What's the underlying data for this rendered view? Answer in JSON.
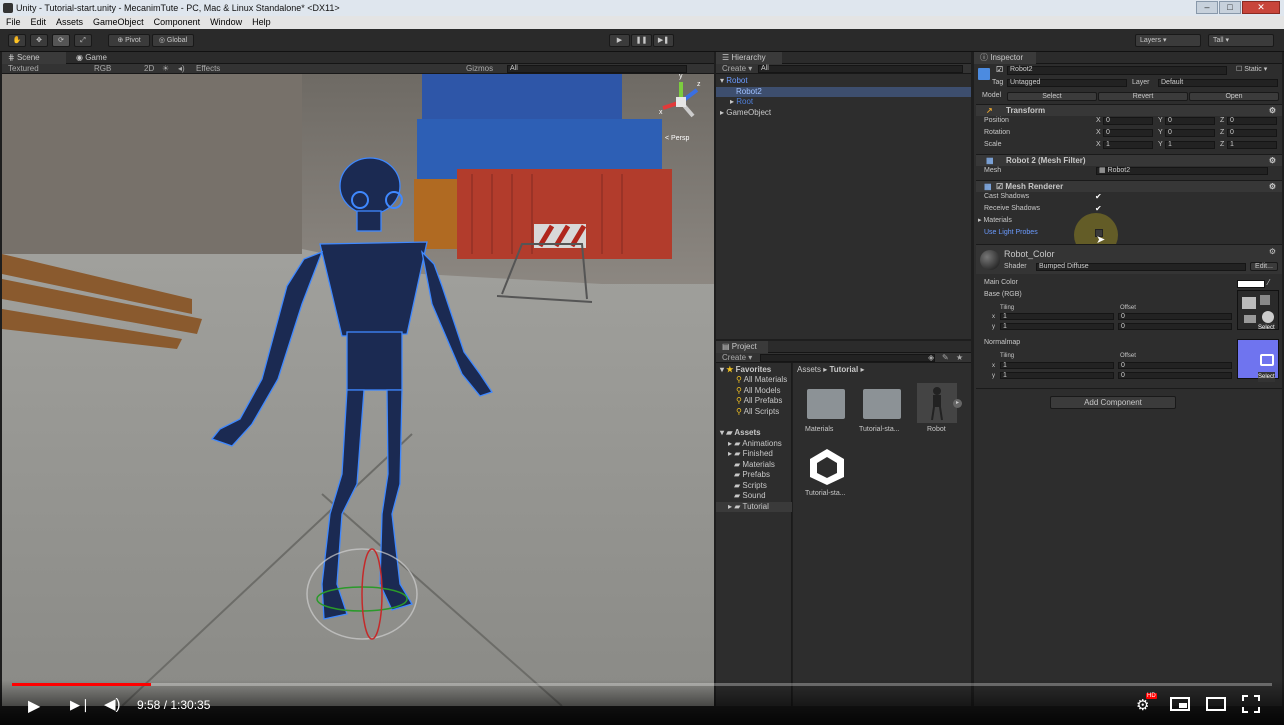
{
  "window": {
    "title": "Unity - Tutorial-start.unity - MecanimTute - PC, Mac & Linux Standalone* <DX11>"
  },
  "menu": [
    "File",
    "Edit",
    "Assets",
    "GameObject",
    "Component",
    "Window",
    "Help"
  ],
  "toolbar": {
    "pivot": "Pivot",
    "global": "Global",
    "layers": "Layers",
    "layout": "Tall"
  },
  "scene": {
    "tab_scene": "Scene",
    "tab_game": "Game",
    "shading": "Textured",
    "render": "RGB",
    "mode2d": "2D",
    "effects": "Effects",
    "gizmos": "Gizmos",
    "search_placeholder": "All",
    "persp": "Persp",
    "gizmo_x": "x",
    "gizmo_y": "y",
    "gizmo_z": "z"
  },
  "hierarchy": {
    "tab": "Hierarchy",
    "create": "Create",
    "search_placeholder": "All",
    "items": [
      {
        "label": "Robot",
        "color": "#6b9bff"
      },
      {
        "label": "Robot2",
        "color": "#6b9bff"
      },
      {
        "label": "Root",
        "color": "#4f7fd9"
      },
      {
        "label": "GameObject",
        "color": "#c8c8c8"
      }
    ]
  },
  "project": {
    "tab": "Project",
    "create": "Create",
    "favorites": "Favorites",
    "fav_items": [
      "All Materials",
      "All Models",
      "All Prefabs",
      "All Scripts"
    ],
    "assets": "Assets",
    "asset_folders": [
      "Animations",
      "Finished",
      "Materials",
      "Prefabs",
      "Scripts",
      "Sound",
      "Tutorial"
    ],
    "breadcrumb_root": "Assets",
    "breadcrumb_current": "Tutorial",
    "grid": [
      "Materials",
      "Tutorial-sta...",
      "Robot",
      "Tutorial-sta..."
    ]
  },
  "inspector": {
    "tab": "Inspector",
    "object_name": "Robot2",
    "static": "Static",
    "tag_label": "Tag",
    "tag_value": "Untagged",
    "layer_label": "Layer",
    "layer_value": "Default",
    "model_label": "Model",
    "select": "Select",
    "revert": "Revert",
    "open": "Open",
    "transform": "Transform",
    "position": "Position",
    "rotation": "Rotation",
    "scale": "Scale",
    "ax": "X",
    "ay": "Y",
    "az": "Z",
    "pos": [
      "0",
      "0",
      "0"
    ],
    "rot": [
      "0",
      "0",
      "0"
    ],
    "scl": [
      "1",
      "1",
      "1"
    ],
    "mesh_filter": "Robot 2 (Mesh Filter)",
    "mesh_label": "Mesh",
    "mesh_value": "Robot2",
    "mesh_renderer": "Mesh Renderer",
    "cast_shadows": "Cast Shadows",
    "receive_shadows": "Receive Shadows",
    "materials": "Materials",
    "use_light_probes": "Use Light Probes",
    "material_name": "Robot_Color",
    "shader_label": "Shader",
    "shader_value": "Bumped Diffuse",
    "edit": "Edit...",
    "main_color": "Main Color",
    "base_rgb": "Base (RGB)",
    "tiling": "Tiling",
    "offset": "Offset",
    "x": "x",
    "y": "y",
    "base_tiling": [
      "1",
      "1"
    ],
    "base_offset": [
      "0",
      "0"
    ],
    "normalmap": "Normalmap",
    "normal_tiling": [
      "1",
      "1"
    ],
    "normal_offset": [
      "0",
      "0"
    ],
    "select_tex": "Select",
    "add_component": "Add Component"
  },
  "player": {
    "time": "9:58 / 1:30:35",
    "progress": 0.11,
    "hd": "HD"
  }
}
